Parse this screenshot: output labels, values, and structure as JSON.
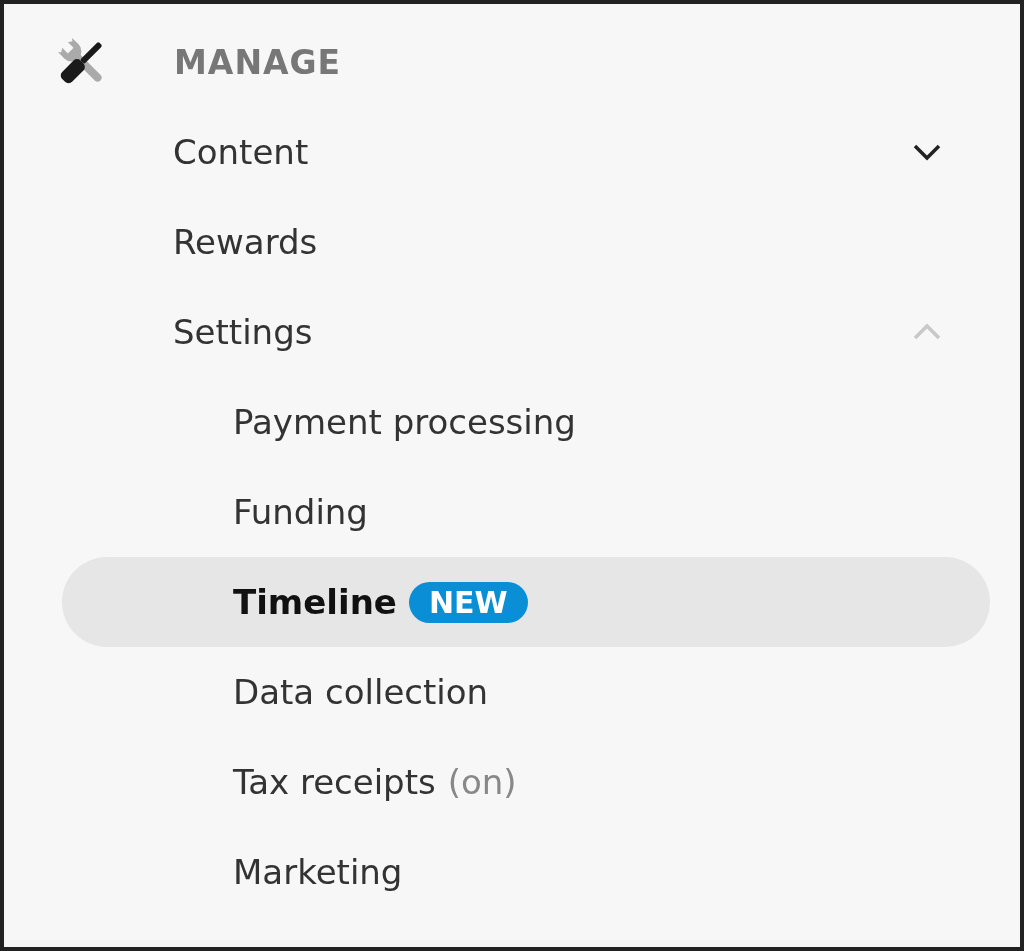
{
  "section": {
    "title": "MANAGE"
  },
  "items": [
    {
      "kind": "group",
      "label": "Content",
      "expanded": false
    },
    {
      "kind": "link",
      "label": "Rewards"
    },
    {
      "kind": "group",
      "label": "Settings",
      "expanded": true,
      "children": [
        {
          "label": "Payment processing",
          "selected": false
        },
        {
          "label": "Funding",
          "selected": false
        },
        {
          "label": "Timeline",
          "selected": true,
          "badge": "NEW"
        },
        {
          "label": "Data collection",
          "selected": false
        },
        {
          "label": "Tax receipts",
          "selected": false,
          "note": "(on)"
        },
        {
          "label": "Marketing",
          "selected": false
        }
      ]
    }
  ]
}
